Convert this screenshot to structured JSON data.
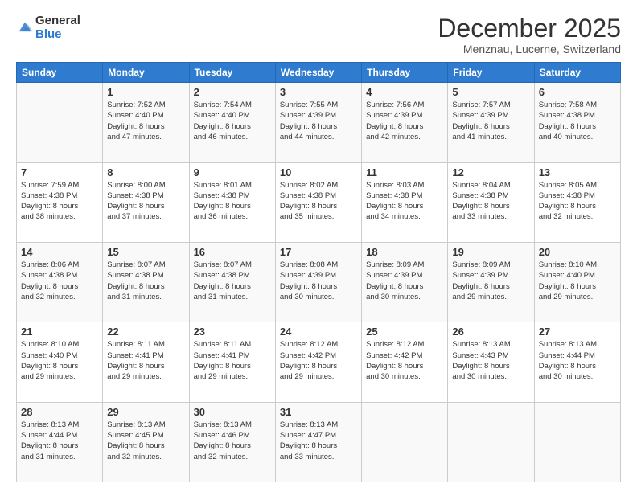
{
  "logo": {
    "general": "General",
    "blue": "Blue"
  },
  "header": {
    "month": "December 2025",
    "location": "Menznau, Lucerne, Switzerland"
  },
  "weekdays": [
    "Sunday",
    "Monday",
    "Tuesday",
    "Wednesday",
    "Thursday",
    "Friday",
    "Saturday"
  ],
  "weeks": [
    [
      {
        "day": "",
        "sunrise": "",
        "sunset": "",
        "daylight": ""
      },
      {
        "day": "1",
        "sunrise": "Sunrise: 7:52 AM",
        "sunset": "Sunset: 4:40 PM",
        "daylight": "Daylight: 8 hours and 47 minutes."
      },
      {
        "day": "2",
        "sunrise": "Sunrise: 7:54 AM",
        "sunset": "Sunset: 4:40 PM",
        "daylight": "Daylight: 8 hours and 46 minutes."
      },
      {
        "day": "3",
        "sunrise": "Sunrise: 7:55 AM",
        "sunset": "Sunset: 4:39 PM",
        "daylight": "Daylight: 8 hours and 44 minutes."
      },
      {
        "day": "4",
        "sunrise": "Sunrise: 7:56 AM",
        "sunset": "Sunset: 4:39 PM",
        "daylight": "Daylight: 8 hours and 42 minutes."
      },
      {
        "day": "5",
        "sunrise": "Sunrise: 7:57 AM",
        "sunset": "Sunset: 4:39 PM",
        "daylight": "Daylight: 8 hours and 41 minutes."
      },
      {
        "day": "6",
        "sunrise": "Sunrise: 7:58 AM",
        "sunset": "Sunset: 4:38 PM",
        "daylight": "Daylight: 8 hours and 40 minutes."
      }
    ],
    [
      {
        "day": "7",
        "sunrise": "Sunrise: 7:59 AM",
        "sunset": "Sunset: 4:38 PM",
        "daylight": "Daylight: 8 hours and 38 minutes."
      },
      {
        "day": "8",
        "sunrise": "Sunrise: 8:00 AM",
        "sunset": "Sunset: 4:38 PM",
        "daylight": "Daylight: 8 hours and 37 minutes."
      },
      {
        "day": "9",
        "sunrise": "Sunrise: 8:01 AM",
        "sunset": "Sunset: 4:38 PM",
        "daylight": "Daylight: 8 hours and 36 minutes."
      },
      {
        "day": "10",
        "sunrise": "Sunrise: 8:02 AM",
        "sunset": "Sunset: 4:38 PM",
        "daylight": "Daylight: 8 hours and 35 minutes."
      },
      {
        "day": "11",
        "sunrise": "Sunrise: 8:03 AM",
        "sunset": "Sunset: 4:38 PM",
        "daylight": "Daylight: 8 hours and 34 minutes."
      },
      {
        "day": "12",
        "sunrise": "Sunrise: 8:04 AM",
        "sunset": "Sunset: 4:38 PM",
        "daylight": "Daylight: 8 hours and 33 minutes."
      },
      {
        "day": "13",
        "sunrise": "Sunrise: 8:05 AM",
        "sunset": "Sunset: 4:38 PM",
        "daylight": "Daylight: 8 hours and 32 minutes."
      }
    ],
    [
      {
        "day": "14",
        "sunrise": "Sunrise: 8:06 AM",
        "sunset": "Sunset: 4:38 PM",
        "daylight": "Daylight: 8 hours and 32 minutes."
      },
      {
        "day": "15",
        "sunrise": "Sunrise: 8:07 AM",
        "sunset": "Sunset: 4:38 PM",
        "daylight": "Daylight: 8 hours and 31 minutes."
      },
      {
        "day": "16",
        "sunrise": "Sunrise: 8:07 AM",
        "sunset": "Sunset: 4:38 PM",
        "daylight": "Daylight: 8 hours and 31 minutes."
      },
      {
        "day": "17",
        "sunrise": "Sunrise: 8:08 AM",
        "sunset": "Sunset: 4:39 PM",
        "daylight": "Daylight: 8 hours and 30 minutes."
      },
      {
        "day": "18",
        "sunrise": "Sunrise: 8:09 AM",
        "sunset": "Sunset: 4:39 PM",
        "daylight": "Daylight: 8 hours and 30 minutes."
      },
      {
        "day": "19",
        "sunrise": "Sunrise: 8:09 AM",
        "sunset": "Sunset: 4:39 PM",
        "daylight": "Daylight: 8 hours and 29 minutes."
      },
      {
        "day": "20",
        "sunrise": "Sunrise: 8:10 AM",
        "sunset": "Sunset: 4:40 PM",
        "daylight": "Daylight: 8 hours and 29 minutes."
      }
    ],
    [
      {
        "day": "21",
        "sunrise": "Sunrise: 8:10 AM",
        "sunset": "Sunset: 4:40 PM",
        "daylight": "Daylight: 8 hours and 29 minutes."
      },
      {
        "day": "22",
        "sunrise": "Sunrise: 8:11 AM",
        "sunset": "Sunset: 4:41 PM",
        "daylight": "Daylight: 8 hours and 29 minutes."
      },
      {
        "day": "23",
        "sunrise": "Sunrise: 8:11 AM",
        "sunset": "Sunset: 4:41 PM",
        "daylight": "Daylight: 8 hours and 29 minutes."
      },
      {
        "day": "24",
        "sunrise": "Sunrise: 8:12 AM",
        "sunset": "Sunset: 4:42 PM",
        "daylight": "Daylight: 8 hours and 29 minutes."
      },
      {
        "day": "25",
        "sunrise": "Sunrise: 8:12 AM",
        "sunset": "Sunset: 4:42 PM",
        "daylight": "Daylight: 8 hours and 30 minutes."
      },
      {
        "day": "26",
        "sunrise": "Sunrise: 8:13 AM",
        "sunset": "Sunset: 4:43 PM",
        "daylight": "Daylight: 8 hours and 30 minutes."
      },
      {
        "day": "27",
        "sunrise": "Sunrise: 8:13 AM",
        "sunset": "Sunset: 4:44 PM",
        "daylight": "Daylight: 8 hours and 30 minutes."
      }
    ],
    [
      {
        "day": "28",
        "sunrise": "Sunrise: 8:13 AM",
        "sunset": "Sunset: 4:44 PM",
        "daylight": "Daylight: 8 hours and 31 minutes."
      },
      {
        "day": "29",
        "sunrise": "Sunrise: 8:13 AM",
        "sunset": "Sunset: 4:45 PM",
        "daylight": "Daylight: 8 hours and 32 minutes."
      },
      {
        "day": "30",
        "sunrise": "Sunrise: 8:13 AM",
        "sunset": "Sunset: 4:46 PM",
        "daylight": "Daylight: 8 hours and 32 minutes."
      },
      {
        "day": "31",
        "sunrise": "Sunrise: 8:13 AM",
        "sunset": "Sunset: 4:47 PM",
        "daylight": "Daylight: 8 hours and 33 minutes."
      },
      {
        "day": "",
        "sunrise": "",
        "sunset": "",
        "daylight": ""
      },
      {
        "day": "",
        "sunrise": "",
        "sunset": "",
        "daylight": ""
      },
      {
        "day": "",
        "sunrise": "",
        "sunset": "",
        "daylight": ""
      }
    ]
  ]
}
